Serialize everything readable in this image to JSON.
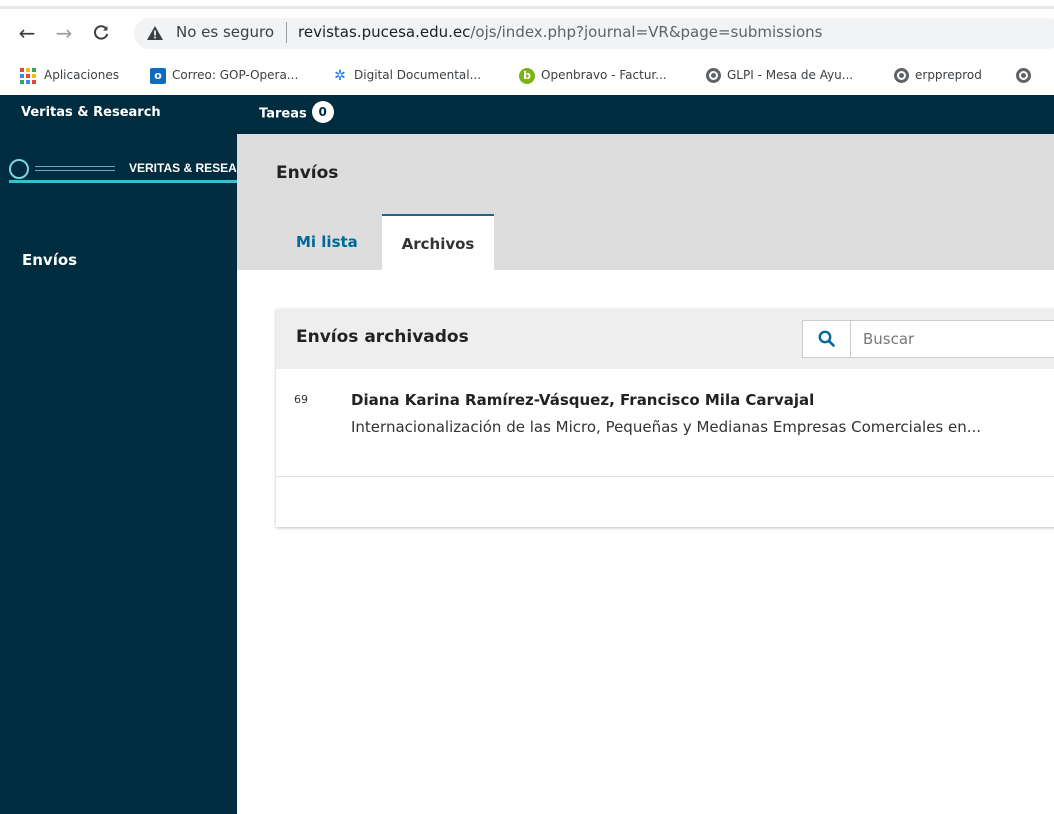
{
  "browser": {
    "insecure_label": "No es seguro",
    "url_host": "revistas.pucesa.edu.ec",
    "url_path": "/ojs/index.php?journal=VR&page=submissions",
    "bookmarks": [
      {
        "label": "Aplicaciones",
        "icon": "apps-grid-icon"
      },
      {
        "label": "Correo: GOP-Opera...",
        "icon": "outlook-icon"
      },
      {
        "label": "Digital Documental...",
        "icon": "digital-documental-icon"
      },
      {
        "label": "Openbravo - Factur...",
        "icon": "openbravo-icon"
      },
      {
        "label": "GLPI - Mesa de Ayu...",
        "icon": "globe-icon"
      },
      {
        "label": "erppreprod",
        "icon": "globe-icon"
      }
    ]
  },
  "header": {
    "brand": "Veritas & Research",
    "tasks_label": "Tareas",
    "tasks_count": "0"
  },
  "sidebar": {
    "logo_text": "VERITAS & RESEARCH",
    "items": [
      {
        "label": "Envíos"
      }
    ]
  },
  "page": {
    "title": "Envíos",
    "tabs": [
      {
        "label": "Mi lista",
        "active": false
      },
      {
        "label": "Archivos",
        "active": true
      }
    ]
  },
  "panel": {
    "title": "Envíos archivados",
    "search_placeholder": "Buscar",
    "submissions": [
      {
        "id": "69",
        "authors": "Diana Karina Ramírez-Vásquez, Francisco Mila Carvajal",
        "title": "Internacionalización de las Micro, Pequeñas y Medianas Empresas Comerciales en..."
      }
    ]
  },
  "colors": {
    "navy": "#002c40",
    "accent": "#006798",
    "logo_stripe": "#3ac0cf"
  }
}
